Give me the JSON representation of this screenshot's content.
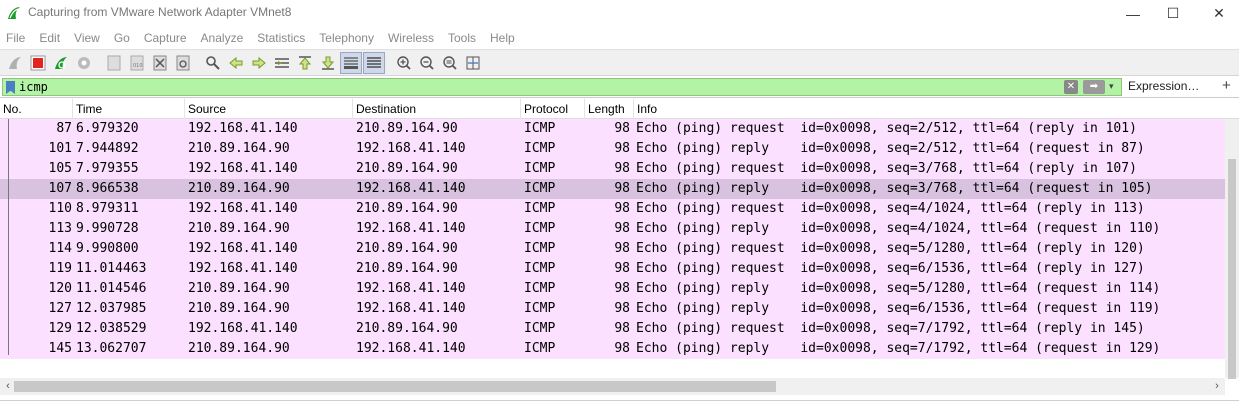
{
  "window": {
    "title": "Capturing from VMware Network Adapter VMnet8",
    "min_glyph": "—",
    "max_glyph": "☐",
    "close_glyph": "✕"
  },
  "menu": [
    "File",
    "Edit",
    "View",
    "Go",
    "Capture",
    "Analyze",
    "Statistics",
    "Telephony",
    "Wireless",
    "Tools",
    "Help"
  ],
  "toolbar": {
    "icons": [
      "shark-fin-start-icon",
      "stop-capture-icon",
      "restart-capture-icon",
      "capture-options-icon",
      "separator",
      "open-file-icon",
      "save-file-icon",
      "close-file-icon",
      "reload-file-icon",
      "separator",
      "find-packet-icon",
      "go-back-icon",
      "go-forward-icon",
      "go-to-packet-icon",
      "go-first-icon",
      "go-last-icon",
      "auto-scroll-icon",
      "colorize-icon",
      "separator",
      "zoom-in-icon",
      "zoom-out-icon",
      "normal-size-icon",
      "resize-columns-icon"
    ]
  },
  "filter": {
    "value": "icmp",
    "clear_glyph": "✕",
    "apply_glyph": "➡",
    "dropdown_glyph": "▾",
    "expression_label": "Expression…",
    "plus_label": "+"
  },
  "columns": [
    "No.",
    "Time",
    "Source",
    "Destination",
    "Protocol",
    "Length",
    "Info"
  ],
  "packets": [
    {
      "no": "87",
      "time": "6.979320",
      "src": "192.168.41.140",
      "dst": "210.89.164.90",
      "proto": "ICMP",
      "len": "98",
      "info": "Echo (ping) request  id=0x0098, seq=2/512, ttl=64 (reply in 101)"
    },
    {
      "no": "101",
      "time": "7.944892",
      "src": "210.89.164.90",
      "dst": "192.168.41.140",
      "proto": "ICMP",
      "len": "98",
      "info": "Echo (ping) reply    id=0x0098, seq=2/512, ttl=64 (request in 87)"
    },
    {
      "no": "105",
      "time": "7.979355",
      "src": "192.168.41.140",
      "dst": "210.89.164.90",
      "proto": "ICMP",
      "len": "98",
      "info": "Echo (ping) request  id=0x0098, seq=3/768, ttl=64 (reply in 107)"
    },
    {
      "no": "107",
      "time": "8.966538",
      "src": "210.89.164.90",
      "dst": "192.168.41.140",
      "proto": "ICMP",
      "len": "98",
      "info": "Echo (ping) reply    id=0x0098, seq=3/768, ttl=64 (request in 105)"
    },
    {
      "no": "110",
      "time": "8.979311",
      "src": "192.168.41.140",
      "dst": "210.89.164.90",
      "proto": "ICMP",
      "len": "98",
      "info": "Echo (ping) request  id=0x0098, seq=4/1024, ttl=64 (reply in 113)"
    },
    {
      "no": "113",
      "time": "9.990728",
      "src": "210.89.164.90",
      "dst": "192.168.41.140",
      "proto": "ICMP",
      "len": "98",
      "info": "Echo (ping) reply    id=0x0098, seq=4/1024, ttl=64 (request in 110)"
    },
    {
      "no": "114",
      "time": "9.990800",
      "src": "192.168.41.140",
      "dst": "210.89.164.90",
      "proto": "ICMP",
      "len": "98",
      "info": "Echo (ping) request  id=0x0098, seq=5/1280, ttl=64 (reply in 120)"
    },
    {
      "no": "119",
      "time": "11.014463",
      "src": "192.168.41.140",
      "dst": "210.89.164.90",
      "proto": "ICMP",
      "len": "98",
      "info": "Echo (ping) request  id=0x0098, seq=6/1536, ttl=64 (reply in 127)"
    },
    {
      "no": "120",
      "time": "11.014546",
      "src": "210.89.164.90",
      "dst": "192.168.41.140",
      "proto": "ICMP",
      "len": "98",
      "info": "Echo (ping) reply    id=0x0098, seq=5/1280, ttl=64 (request in 114)"
    },
    {
      "no": "127",
      "time": "12.037985",
      "src": "210.89.164.90",
      "dst": "192.168.41.140",
      "proto": "ICMP",
      "len": "98",
      "info": "Echo (ping) reply    id=0x0098, seq=6/1536, ttl=64 (request in 119)"
    },
    {
      "no": "129",
      "time": "12.038529",
      "src": "192.168.41.140",
      "dst": "210.89.164.90",
      "proto": "ICMP",
      "len": "98",
      "info": "Echo (ping) request  id=0x0098, seq=7/1792, ttl=64 (reply in 145)"
    },
    {
      "no": "145",
      "time": "13.062707",
      "src": "210.89.164.90",
      "dst": "192.168.41.140",
      "proto": "ICMP",
      "len": "98",
      "info": "Echo (ping) reply    id=0x0098, seq=7/1792, ttl=64 (request in 129)"
    }
  ],
  "selected_packet": "107",
  "colors": {
    "row_bg": "#fce0ff",
    "selected_bg": "#d9c2e0",
    "filter_valid_bg": "#b2f3a6"
  },
  "scroll": {
    "left_glyph": "‹",
    "right_glyph": "›"
  }
}
